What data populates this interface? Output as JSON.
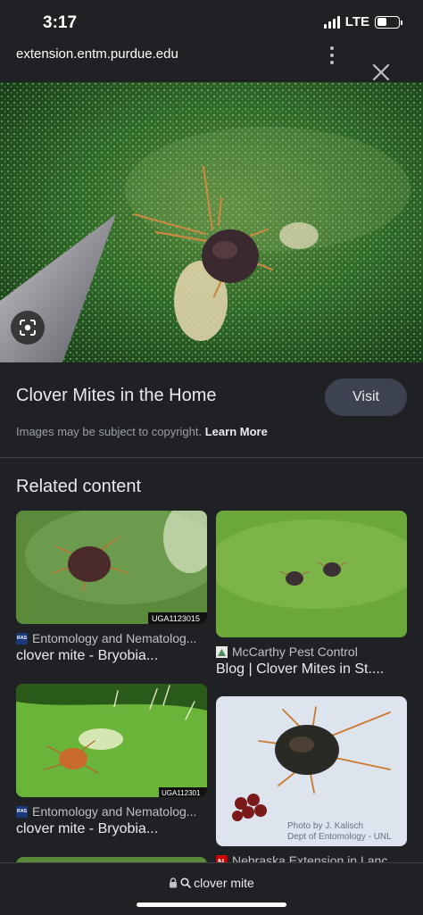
{
  "status_bar": {
    "time": "3:17",
    "network": "LTE",
    "battery_level": 0.45
  },
  "browser": {
    "url": "extension.entm.purdue.edu",
    "more_icon": "more-vertical-icon",
    "close_icon": "close-icon"
  },
  "hero": {
    "lens_icon": "google-lens-icon"
  },
  "result": {
    "title": "Clover Mites in the Home",
    "visit_label": "Visit",
    "copyright_text": "Images may be subject to copyright.",
    "learn_more": "Learn More"
  },
  "related": {
    "heading": "Related content",
    "cards": [
      {
        "source": "Entomology and Nematolog...",
        "caption": "clover mite - Bryobia...",
        "watermark": "UGA1123015",
        "icon_text": "IFAS",
        "icon_color": "#1a3a7a"
      },
      {
        "source": "McCarthy Pest Control",
        "caption": "Blog | Clover Mites in St....",
        "icon_color": "#4a8a5a"
      },
      {
        "source": "Entomology and Nematolog...",
        "caption": "clover mite - Bryobia...",
        "watermark": "UGA112301",
        "icon_text": "IFAS",
        "icon_color": "#1a3a7a"
      },
      {
        "source": "Nebraska Extension in Lanc...",
        "caption": "",
        "watermark_line1": "Photo by J. Kalisch",
        "watermark_line2": "Dept of Entomology - UNL",
        "icon_color": "#d00000"
      }
    ]
  },
  "bottom": {
    "query": "clover mite",
    "lock_icon": "lock-icon",
    "search_icon": "search-icon"
  }
}
